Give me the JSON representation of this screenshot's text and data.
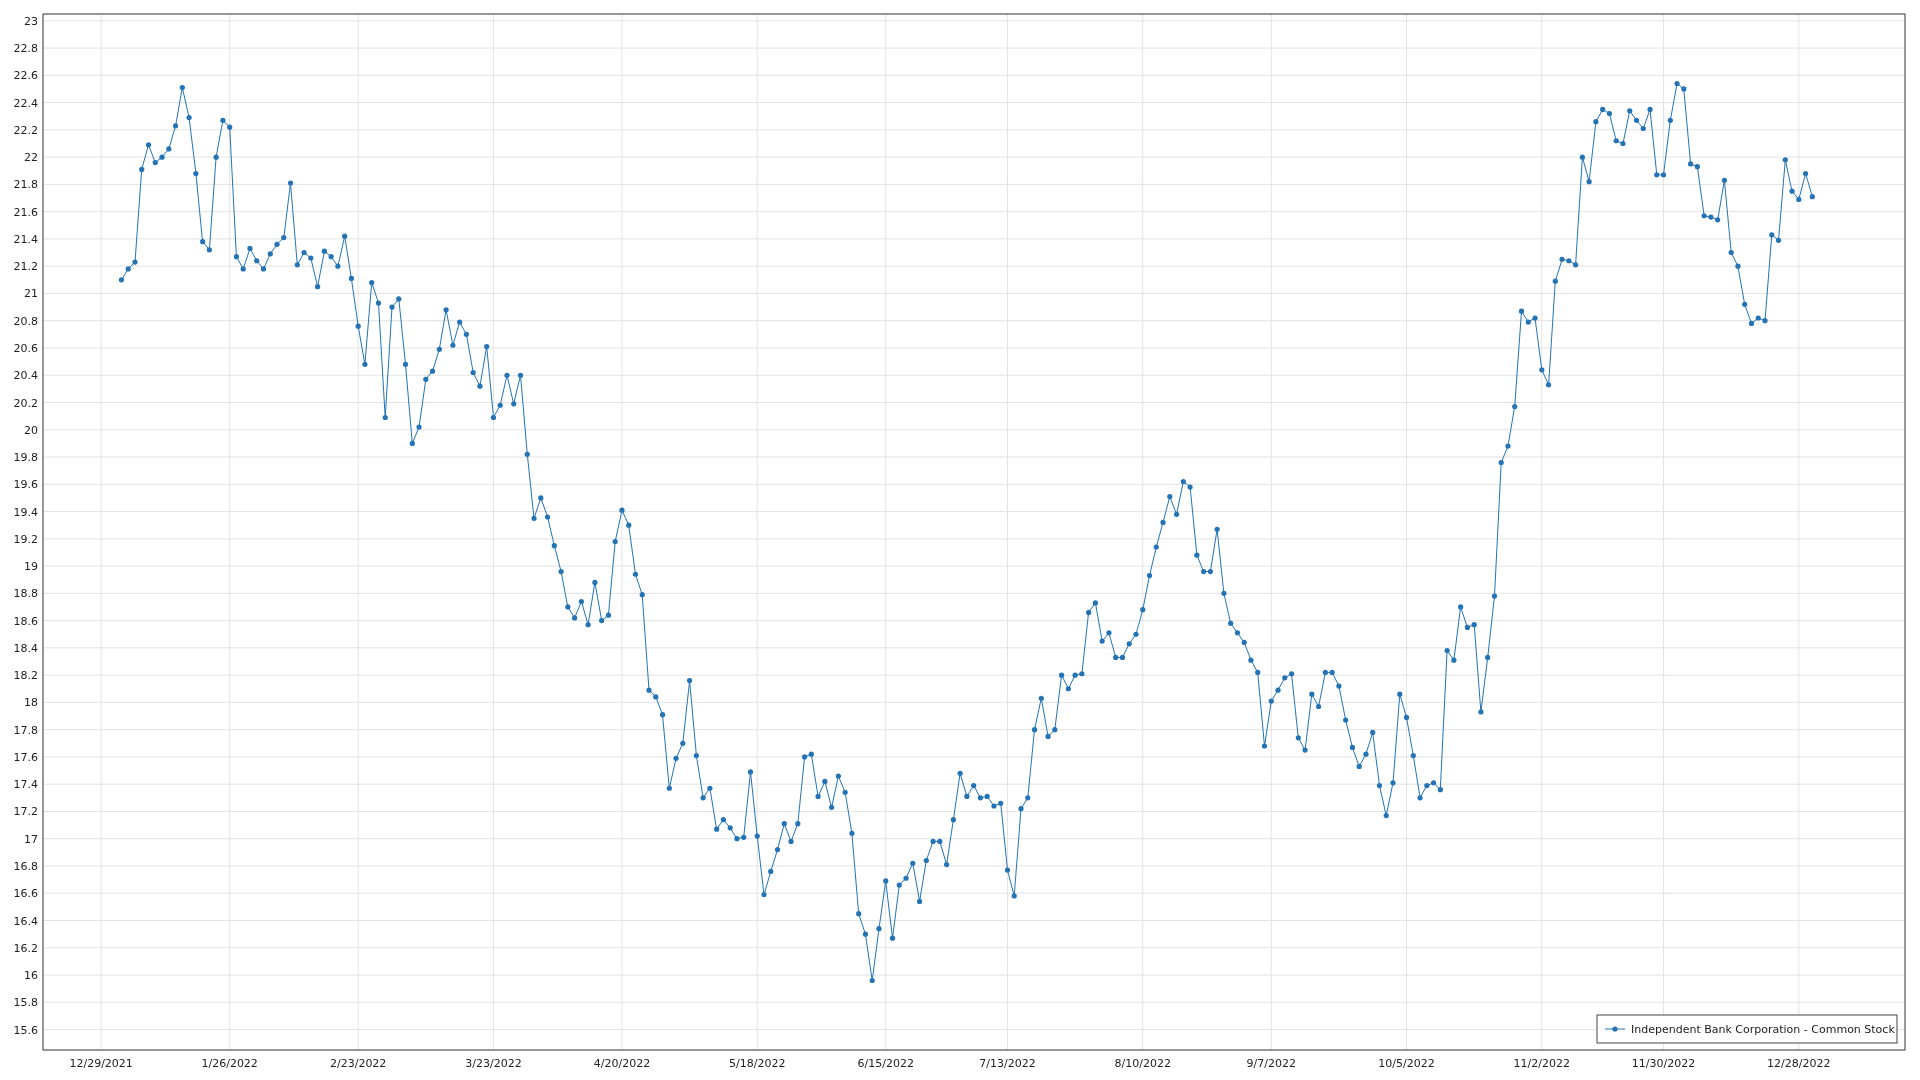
{
  "chart_data": {
    "type": "line",
    "grid": true,
    "categories": [
      "12/29/2021",
      null,
      null,
      null,
      null,
      null,
      null,
      null,
      null,
      null,
      null,
      null,
      null,
      null,
      null,
      null,
      null,
      null,
      null,
      "1/26/2022",
      null,
      null,
      null,
      null,
      null,
      null,
      null,
      null,
      null,
      null,
      null,
      null,
      null,
      null,
      null,
      null,
      null,
      null,
      "2/23/2022",
      null,
      null,
      null,
      null,
      null,
      null,
      null,
      null,
      null,
      null,
      null,
      null,
      null,
      null,
      null,
      null,
      null,
      null,
      null,
      "3/23/2022",
      null,
      null,
      null,
      null,
      null,
      null,
      null,
      null,
      null,
      null,
      null,
      null,
      null,
      null,
      null,
      null,
      null,
      null,
      "4/20/2022",
      null,
      null,
      null,
      null,
      null,
      null,
      null,
      null,
      null,
      null,
      null,
      null,
      null,
      null,
      null,
      null,
      null,
      null,
      null,
      "5/18/2022",
      null,
      null,
      null,
      null,
      null,
      null,
      null,
      null,
      null,
      null,
      null,
      null,
      null,
      null,
      null,
      null,
      null,
      null,
      "6/15/2022",
      null,
      null,
      null,
      null,
      null,
      null,
      null,
      null,
      null,
      null,
      null,
      null,
      null,
      null,
      null,
      null,
      null,
      "7/13/2022",
      null,
      null,
      null,
      null,
      null,
      null,
      null,
      null,
      null,
      null,
      null,
      null,
      null,
      null,
      null,
      null,
      null,
      null,
      null,
      "8/10/2022",
      null,
      null,
      null,
      null,
      null,
      null,
      null,
      null,
      null,
      null,
      null,
      null,
      null,
      null,
      null,
      null,
      null,
      null,
      "9/7/2022",
      null,
      null,
      null,
      null,
      null,
      null,
      null,
      null,
      null,
      null,
      null,
      null,
      null,
      null,
      null,
      null,
      null,
      null,
      null,
      "10/5/2022",
      null,
      null,
      null,
      null,
      null,
      null,
      null,
      null,
      null,
      null,
      null,
      null,
      null,
      null,
      null,
      null,
      null,
      null,
      null,
      "11/2/2022",
      null,
      null,
      null,
      null,
      null,
      null,
      null,
      null,
      null,
      null,
      null,
      null,
      null,
      null,
      null,
      null,
      null,
      "11/30/2022",
      null,
      null,
      null,
      null,
      null,
      null,
      null,
      null,
      null,
      null,
      null,
      null,
      null,
      null,
      null,
      null,
      null,
      null,
      null,
      "12/28/2022",
      null,
      null
    ],
    "series": [
      {
        "name": "Independent Bank Corporation - Common Stock",
        "color": "#2474b5",
        "values": [
          null,
          null,
          null,
          21.1,
          21.18,
          21.23,
          21.91,
          22.09,
          21.96,
          22.0,
          22.06,
          22.23,
          22.51,
          22.29,
          21.88,
          21.38,
          21.32,
          22.0,
          22.27,
          22.22,
          21.27,
          21.18,
          21.33,
          21.24,
          21.18,
          21.29,
          21.36,
          21.41,
          21.81,
          21.21,
          21.3,
          21.26,
          21.05,
          21.31,
          21.27,
          21.2,
          21.42,
          21.11,
          20.76,
          20.48,
          21.08,
          20.93,
          20.09,
          20.9,
          20.96,
          20.48,
          19.9,
          20.02,
          20.37,
          20.43,
          20.59,
          20.88,
          20.62,
          20.79,
          20.7,
          20.42,
          20.32,
          20.61,
          20.09,
          20.18,
          20.4,
          20.19,
          20.4,
          19.82,
          19.35,
          19.5,
          19.36,
          19.15,
          18.96,
          18.7,
          18.62,
          18.74,
          18.57,
          18.88,
          18.6,
          18.64,
          19.18,
          19.41,
          19.3,
          18.94,
          18.79,
          18.09,
          18.04,
          17.91,
          17.37,
          17.59,
          17.7,
          18.16,
          17.61,
          17.3,
          17.37,
          17.07,
          17.14,
          17.08,
          17.0,
          17.01,
          17.49,
          17.02,
          16.59,
          16.76,
          16.92,
          17.11,
          16.98,
          17.11,
          17.6,
          17.62,
          17.31,
          17.42,
          17.23,
          17.46,
          17.34,
          17.04,
          16.45,
          16.3,
          15.96,
          16.34,
          16.69,
          16.27,
          16.66,
          16.71,
          16.82,
          16.54,
          16.84,
          16.98,
          16.98,
          16.81,
          17.14,
          17.48,
          17.31,
          17.39,
          17.3,
          17.31,
          17.24,
          17.26,
          16.77,
          16.58,
          17.22,
          17.3,
          17.8,
          18.03,
          17.75,
          17.8,
          18.2,
          18.1,
          18.2,
          18.21,
          18.66,
          18.73,
          18.45,
          18.51,
          18.33,
          18.33,
          18.43,
          18.5,
          18.68,
          18.93,
          19.14,
          19.32,
          19.51,
          19.38,
          19.62,
          19.58,
          19.08,
          18.96,
          18.96,
          19.27,
          18.8,
          18.58,
          18.51,
          18.44,
          18.31,
          18.22,
          17.68,
          18.01,
          18.09,
          18.18,
          18.21,
          17.74,
          17.65,
          18.06,
          17.97,
          18.22,
          18.22,
          18.12,
          17.87,
          17.67,
          17.53,
          17.62,
          17.78,
          17.39,
          17.17,
          17.41,
          18.06,
          17.89,
          17.61,
          17.3,
          17.39,
          17.41,
          17.36,
          18.38,
          18.31,
          18.7,
          18.55,
          18.57,
          17.93,
          18.33,
          18.78,
          19.76,
          19.88,
          20.17,
          20.87,
          20.79,
          20.82,
          20.44,
          20.33,
          21.09,
          21.25,
          21.24,
          21.21,
          22.0,
          21.82,
          22.26,
          22.35,
          22.32,
          22.12,
          22.1,
          22.34,
          22.27,
          22.21,
          22.35,
          21.87,
          21.87,
          22.27,
          22.54,
          22.5,
          21.95,
          21.93,
          21.57,
          21.56,
          21.54,
          21.83,
          21.3,
          21.2,
          20.92,
          20.78,
          20.82,
          20.8,
          21.43,
          21.39,
          21.98,
          21.75,
          21.69,
          21.88,
          21.71
        ]
      }
    ],
    "ylim": [
      15.45,
      23.05
    ],
    "yticks": [
      15.6,
      15.8,
      16,
      16.2,
      16.4,
      16.6,
      16.8,
      17,
      17.2,
      17.4,
      17.6,
      17.8,
      18,
      18.2,
      18.4,
      18.6,
      18.8,
      19,
      19.2,
      19.4,
      19.6,
      19.8,
      20,
      20.2,
      20.4,
      20.6,
      20.8,
      21,
      21.2,
      21.4,
      21.6,
      21.8,
      22,
      22.2,
      22.4,
      22.6,
      22.8,
      23
    ]
  }
}
